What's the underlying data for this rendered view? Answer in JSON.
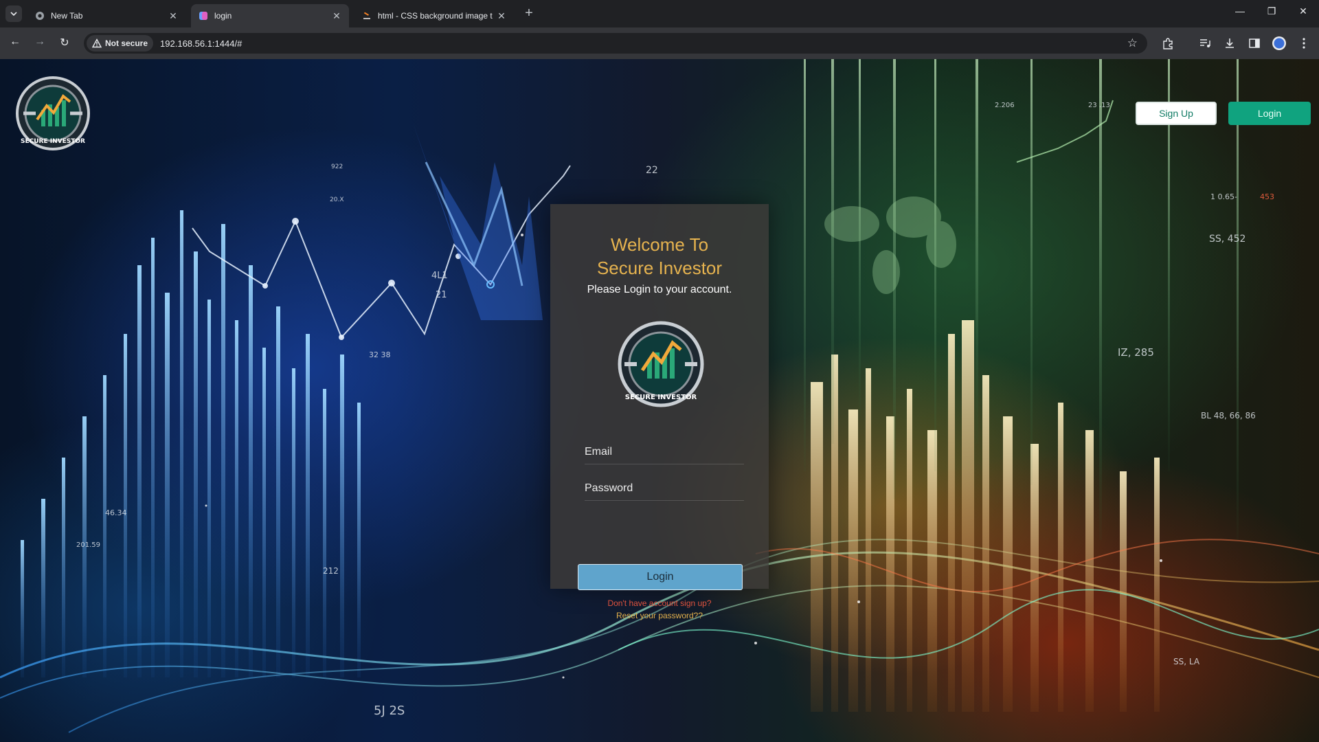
{
  "browser": {
    "tabs": [
      {
        "title": "New Tab",
        "active": false
      },
      {
        "title": "login",
        "active": true
      },
      {
        "title": "html - CSS background image t",
        "active": false
      }
    ],
    "security_label": "Not secure",
    "url": "192.168.56.1:1444/#",
    "profile_initial": "S"
  },
  "header": {
    "signup_label": "Sign Up",
    "login_label": "Login",
    "accent_color": "#10a37f"
  },
  "card": {
    "title_line1": "Welcome To",
    "title_line2": "Secure Investor",
    "subtitle": "Please Login to your account.",
    "email_placeholder": "Email",
    "password_placeholder": "Password",
    "login_button": "Login",
    "signup_link": "Don't have account sign up?",
    "reset_link": "Reset your password??"
  },
  "logo": {
    "text": "SECURE INVESTOR"
  },
  "background_numbers": [
    "22",
    "4L1",
    "21",
    "32 38",
    "2.206",
    "23 .13",
    "1 0.65-",
    "453",
    "SS, 452",
    "IZ, 285",
    "BL 48, 66, 86",
    "46.34",
    "201.59",
    "212",
    "5J 2S",
    "SS, LA",
    "922",
    "20.X"
  ]
}
